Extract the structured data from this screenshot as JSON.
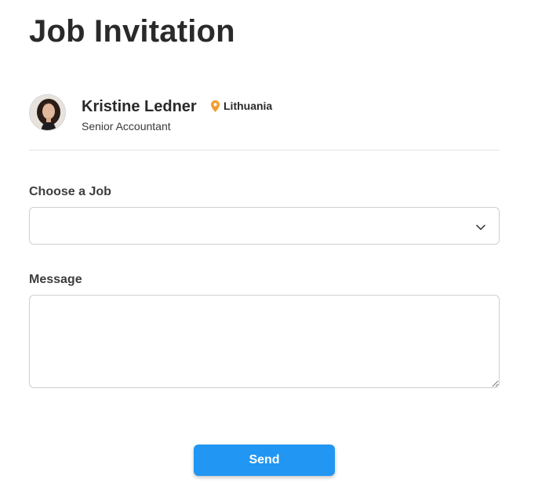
{
  "page": {
    "title": "Job Invitation"
  },
  "candidate": {
    "name": "Kristine Ledner",
    "job_title": "Senior Accountant",
    "location": "Lithuania",
    "location_icon": "map-pin-icon",
    "location_icon_color": "#f39c2c"
  },
  "form": {
    "job_label": "Choose a Job",
    "job_selected": "",
    "job_chevron_icon": "chevron-down-icon",
    "message_label": "Message",
    "message_value": "",
    "send_label": "Send"
  },
  "colors": {
    "accent": "#2196f3",
    "border": "#cfcfcf",
    "divider": "#e3e3e3"
  }
}
